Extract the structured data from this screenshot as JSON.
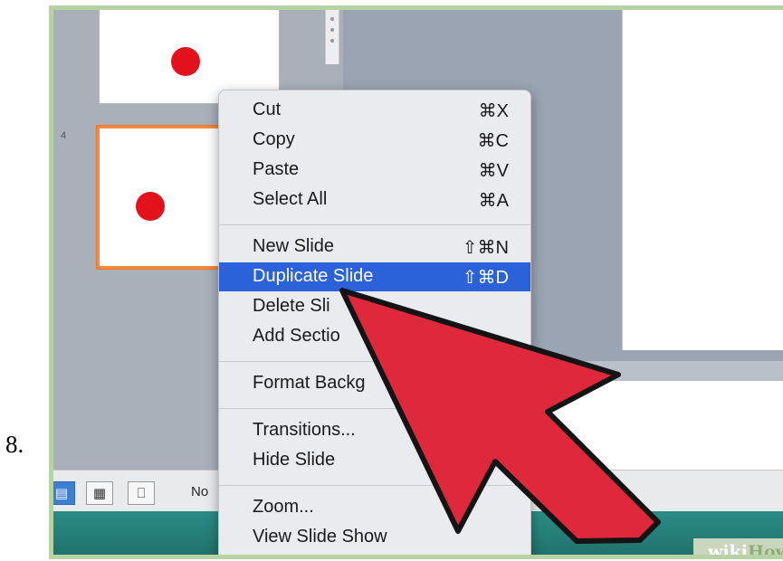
{
  "step_number": "8.",
  "thumbnails": {
    "slide_number": "4"
  },
  "status_bar": {
    "notes_label": "No",
    "views": [
      "normal-view-icon",
      "slide-sorter-icon",
      "presenter-view-icon"
    ]
  },
  "context_menu": {
    "items": [
      {
        "label": "Cut",
        "shortcut": "⌘X"
      },
      {
        "label": "Copy",
        "shortcut": "⌘C"
      },
      {
        "label": "Paste",
        "shortcut": "⌘V"
      },
      {
        "label": "Select All",
        "shortcut": "⌘A"
      },
      {
        "label": "New Slide",
        "shortcut": "⇧⌘N"
      },
      {
        "label": "Duplicate Slide",
        "shortcut": "⇧⌘D",
        "highlighted": true
      },
      {
        "label": "Delete Sli",
        "shortcut": ""
      },
      {
        "label": "Add Sectio",
        "shortcut": ""
      },
      {
        "label": "Format Backg",
        "shortcut": ""
      },
      {
        "label": "Transitions...",
        "shortcut": ""
      },
      {
        "label": "Hide Slide",
        "shortcut": ""
      },
      {
        "label": "Zoom...",
        "shortcut": ""
      },
      {
        "label": "View Slide Show",
        "shortcut": ""
      }
    ]
  },
  "watermark": {
    "wiki": "wiki",
    "how": "How"
  },
  "colors": {
    "highlight": "#2b62d9",
    "arrow_fill": "#e0283c",
    "selected_border": "#f58a3a",
    "dot": "#e3111b"
  }
}
